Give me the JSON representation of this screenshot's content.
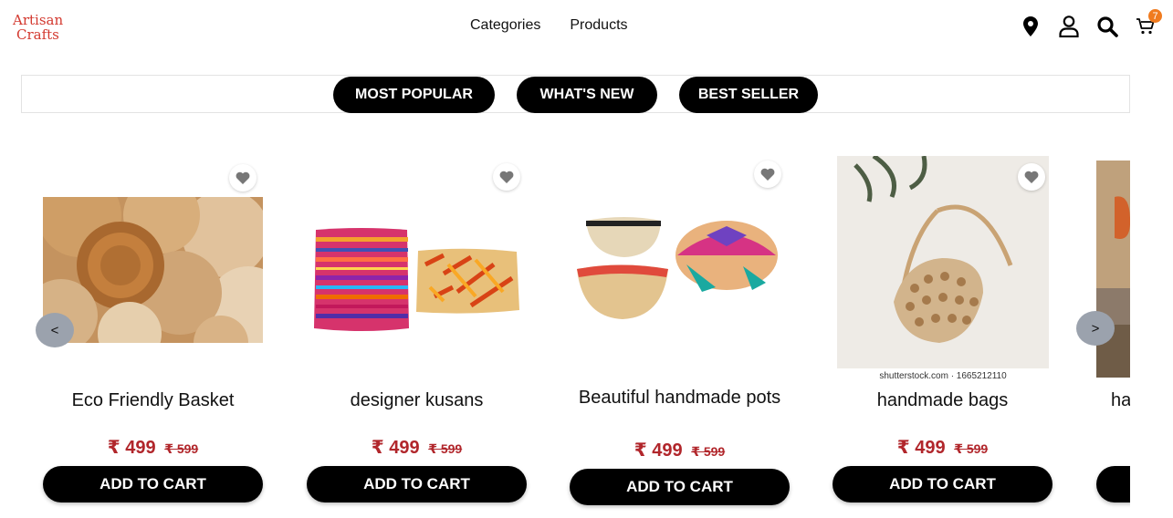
{
  "brand": {
    "line1": "Artisan",
    "line2": "Crafts"
  },
  "nav": {
    "categories": "Categories",
    "products": "Products"
  },
  "header_icons": [
    "location-icon",
    "user-icon",
    "search-icon",
    "cart-icon"
  ],
  "cart_count": "7",
  "filters": [
    "MOST POPULAR",
    "WHAT'S NEW",
    "BEST SELLER"
  ],
  "products": [
    {
      "title": "Eco Friendly Basket",
      "currency": "₹",
      "price": "499",
      "old_price": "₹ 599",
      "button": "ADD TO CART"
    },
    {
      "title": "designer kusans",
      "currency": "₹",
      "price": "499",
      "old_price": "₹ 599",
      "button": "ADD TO CART"
    },
    {
      "title": "Beautiful handmade pots",
      "currency": "₹",
      "price": "499",
      "old_price": "₹ 599",
      "button": "ADD TO CART"
    },
    {
      "title": "handmade bags",
      "currency": "₹",
      "price": "499",
      "old_price": "₹ 599",
      "button": "ADD TO CART",
      "watermark": "shutterstock.com · 1665212110"
    },
    {
      "title": "ha",
      "button": ""
    }
  ],
  "arrows": {
    "prev": "<",
    "next": ">"
  },
  "colors": {
    "brand": "#d3392f",
    "price": "#b1262b",
    "badge": "#f07b1f",
    "button": "#000000"
  }
}
